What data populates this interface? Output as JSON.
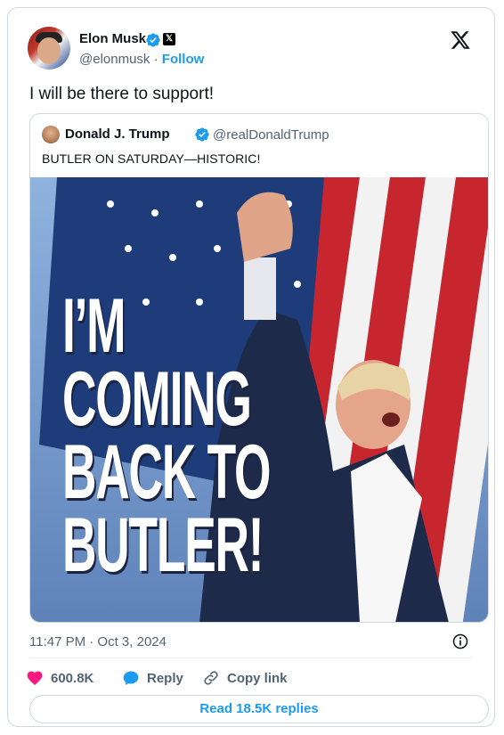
{
  "author": {
    "name": "Elon Musk",
    "handle": "@elonmusk",
    "separator": "·",
    "follow_label": "Follow"
  },
  "tweet": {
    "text": "I will be there to support!",
    "timestamp": "11:47 PM · Oct 3, 2024"
  },
  "quoted": {
    "name": "Donald J. Trump",
    "handle": "@realDonaldTrump",
    "text": "BUTLER ON SATURDAY—HISTORIC!",
    "image_lines": [
      "I’M",
      "COMING",
      "BACK TO",
      "BUTLER!"
    ]
  },
  "actions": {
    "likes": "600.8K",
    "reply_label": "Reply",
    "copy_link_label": "Copy link"
  },
  "footer": {
    "read_replies": "Read 18.5K replies"
  },
  "colors": {
    "accent": "#1d9bf0",
    "like": "#f91880",
    "text": "#0f1419",
    "muted": "#536471",
    "border": "#cfd9de"
  },
  "icons": [
    "verified-icon",
    "x-logo-icon",
    "info-icon",
    "heart-icon",
    "reply-icon",
    "link-icon"
  ]
}
